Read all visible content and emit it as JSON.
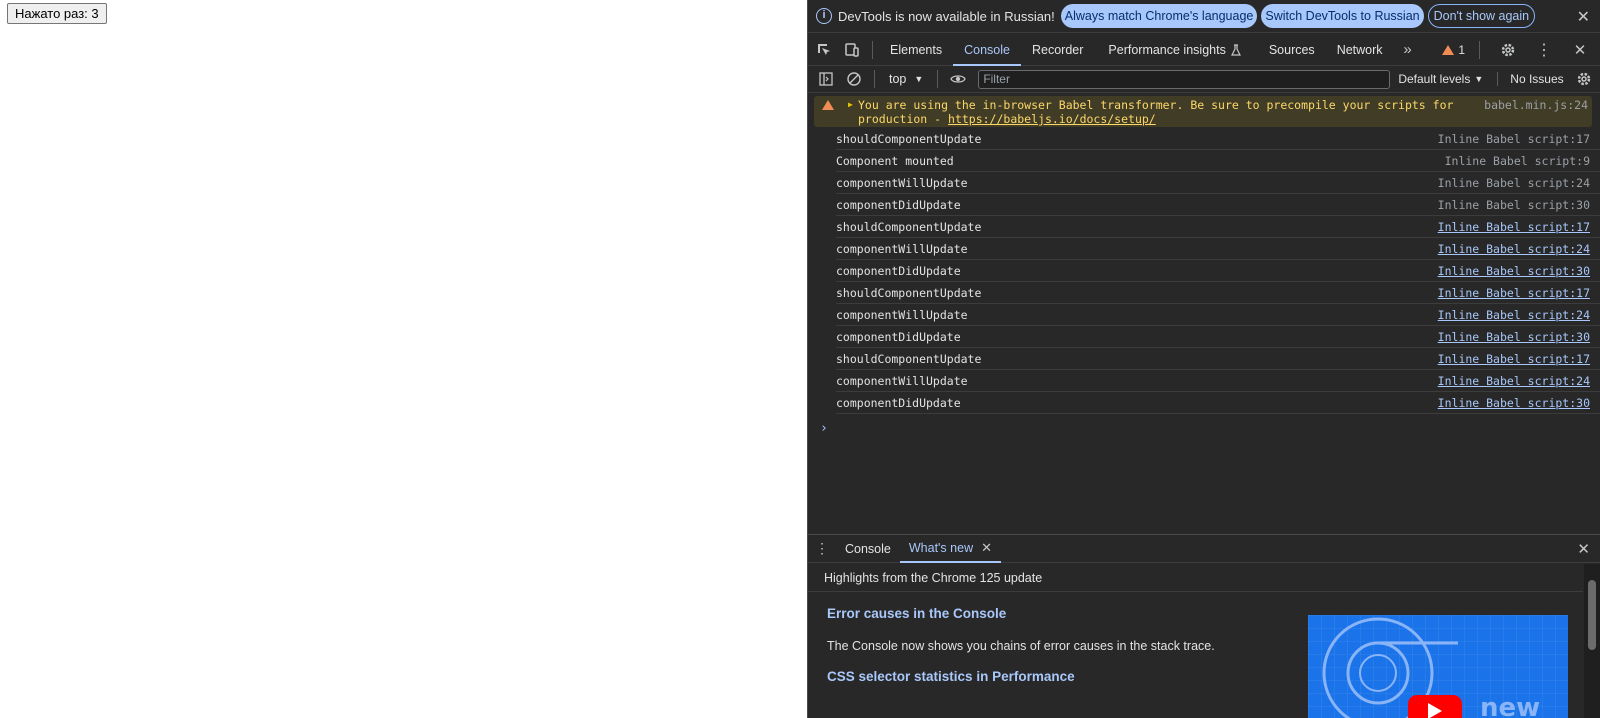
{
  "page": {
    "counter_button": "Нажато раз: 3"
  },
  "infobar": {
    "message": "DevTools is now available in Russian!",
    "btn_match": "Always match Chrome's language",
    "btn_switch": "Switch DevTools to Russian",
    "btn_dismiss": "Don't show again"
  },
  "tabs": {
    "items": [
      "Elements",
      "Console",
      "Recorder",
      "Performance insights",
      "Sources",
      "Network"
    ],
    "active": "Console",
    "warning_count": "1"
  },
  "console_toolbar": {
    "context": "top",
    "filter_placeholder": "Filter",
    "levels": "Default levels",
    "issues": "No Issues"
  },
  "warning": {
    "text": "You are using the in-browser Babel transformer. Be sure to precompile your scripts for production - ",
    "link": "https://babeljs.io/docs/setup/",
    "source": "babel.min.js:24"
  },
  "log": [
    {
      "msg": "shouldComponentUpdate",
      "src": "Inline Babel script:17"
    },
    {
      "msg": "Component mounted",
      "src": "Inline Babel script:9"
    },
    {
      "msg": "componentWillUpdate",
      "src": "Inline Babel script:24"
    },
    {
      "msg": "componentDidUpdate",
      "src": "Inline Babel script:30"
    },
    {
      "msg": "shouldComponentUpdate",
      "src": "Inline Babel script:17"
    },
    {
      "msg": "componentWillUpdate",
      "src": "Inline Babel script:24"
    },
    {
      "msg": "componentDidUpdate",
      "src": "Inline Babel script:30"
    },
    {
      "msg": "shouldComponentUpdate",
      "src": "Inline Babel script:17"
    },
    {
      "msg": "componentWillUpdate",
      "src": "Inline Babel script:24"
    },
    {
      "msg": "componentDidUpdate",
      "src": "Inline Babel script:30"
    },
    {
      "msg": "shouldComponentUpdate",
      "src": "Inline Babel script:17"
    },
    {
      "msg": "componentWillUpdate",
      "src": "Inline Babel script:24"
    },
    {
      "msg": "componentDidUpdate",
      "src": "Inline Babel script:30"
    }
  ],
  "drawer": {
    "tabs": [
      "Console",
      "What's new"
    ],
    "active": "What's new",
    "header": "Highlights from the Chrome 125 update",
    "h1": "Error causes in the Console",
    "p1": "The Console now shows you chains of error causes in the stack trace.",
    "h2": "CSS selector statistics in Performance",
    "thumb_text": "new"
  },
  "colors": {
    "accent": "#a8c7fa",
    "warning_bg": "#413c26",
    "warning_text": "#fcd869",
    "warning_icon": "#f28b54"
  }
}
